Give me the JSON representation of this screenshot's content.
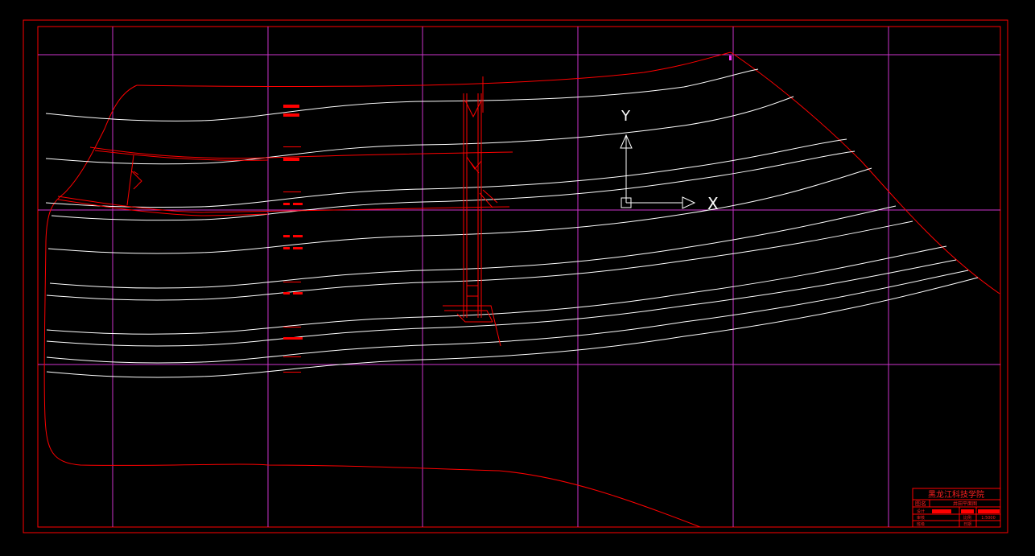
{
  "axis_labels": {
    "x": "X",
    "y": "Y"
  },
  "title_block": {
    "institution": "黑龙江科技学院",
    "label_title": "图名",
    "drawing_name": "井田平面图",
    "label_drawn_by": "设计",
    "label_checked_by": "审核",
    "label_scale": "比例",
    "scale_value": "1:5000",
    "label_date": "日期",
    "label_class": "班级"
  },
  "colors": {
    "background": "#000000",
    "border": "#ff0000",
    "grid": "#cc33cc",
    "contour": "#ffffff",
    "feature": "#ff0000"
  }
}
